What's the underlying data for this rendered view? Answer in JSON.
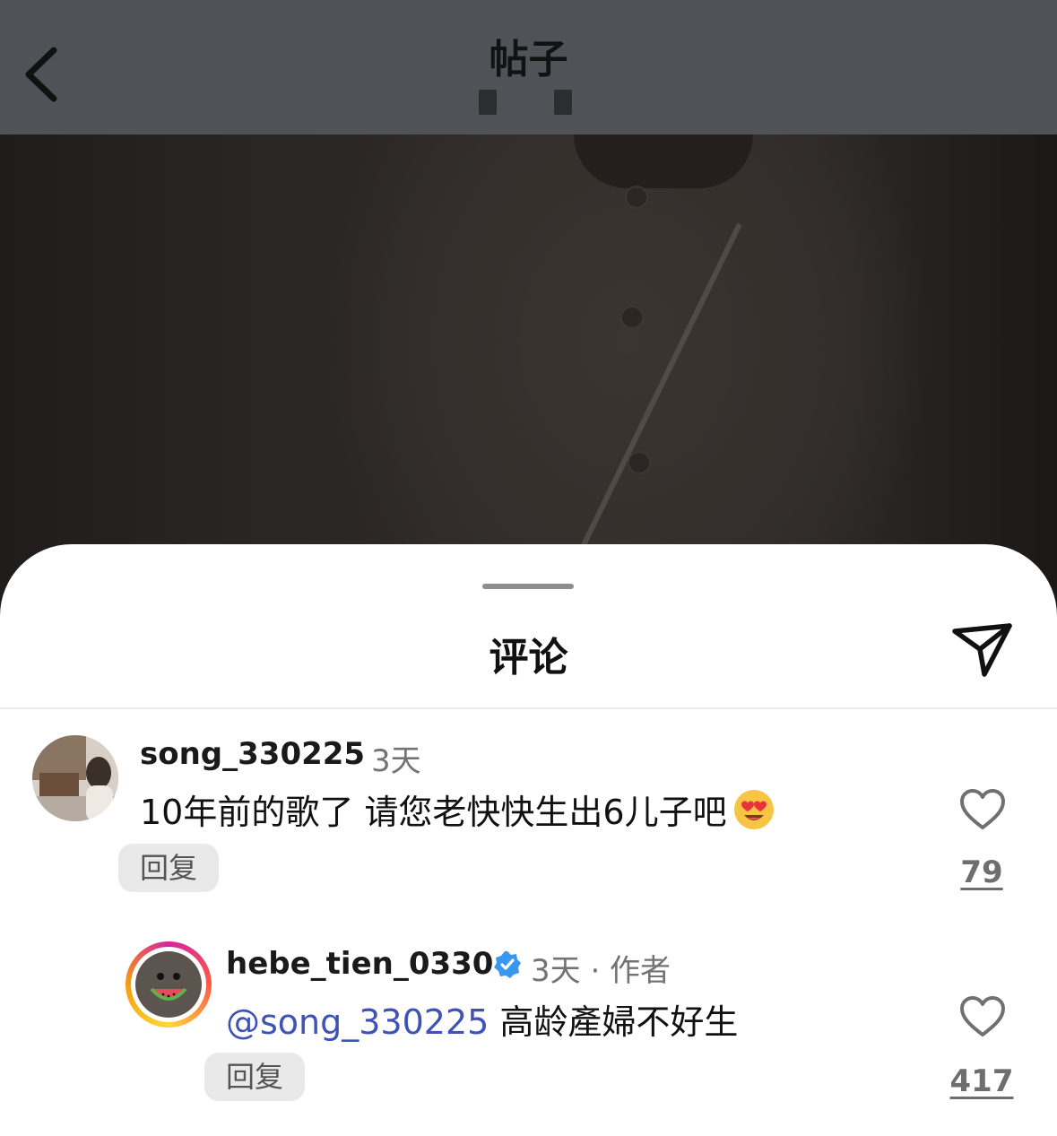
{
  "header": {
    "title": "帖子"
  },
  "comments_sheet": {
    "title": "评论"
  },
  "comments": [
    {
      "username": "song_330225",
      "time": "3天",
      "text": "10年前的歌了 请您老快快生出6儿子吧",
      "emoji": "heart-eyes-emoji",
      "reply_label": "回复",
      "like_count": "79"
    },
    {
      "username": "hebe_tien_0330",
      "verified": true,
      "time": "3天 · 作者",
      "mention": "@song_330225",
      "text": " 高龄產婦不好生",
      "reply_label": "回复",
      "like_count": "417"
    }
  ],
  "colors": {
    "topbar": "#4f5357",
    "mention": "#3f52b5",
    "verified": "#3897f0"
  }
}
